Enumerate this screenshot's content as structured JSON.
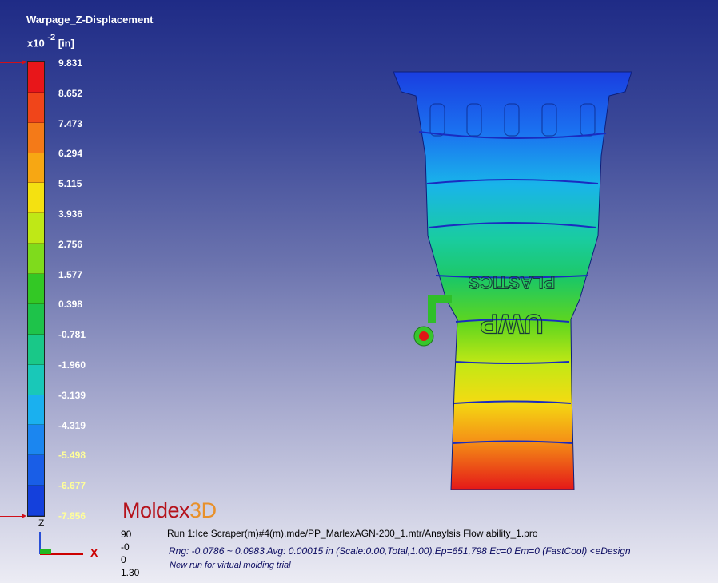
{
  "legend": {
    "title": "Warpage_Z-Displacement",
    "unit_prefix": "x10",
    "unit_exponent": "-2",
    "unit": "[in]",
    "ticks": [
      "9.831",
      "8.652",
      "7.473",
      "6.294",
      "5.115",
      "3.936",
      "2.756",
      "1.577",
      "0.398",
      "-0.781",
      "-1.960",
      "-3.139",
      "-4.319",
      "-5.498",
      "-6.677",
      "-7.856"
    ],
    "colors": [
      "#e8161a",
      "#f0451a",
      "#f47a18",
      "#f7a713",
      "#f4e111",
      "#bfe816",
      "#7fdb1c",
      "#33c825",
      "#1ec34a",
      "#19c888",
      "#19c8b8",
      "#1ab0ef",
      "#1b86f0",
      "#195ee7",
      "#1440dc"
    ]
  },
  "triad": {
    "z_label": "Z",
    "x_label": "X"
  },
  "brand": {
    "name": "Moldex",
    "suffix": "3D"
  },
  "view_values": [
    "90",
    "-0",
    "0",
    "1.30"
  ],
  "info": {
    "run": "Run 1:Ice Scraper(m)#4(m).mde/PP_MarlexAGN-200_1.mtr/Anaylsis Flow ability_1.pro",
    "range": "Rng: -0.0786 ~ 0.0983  Avg: 0.00015 in (Scale:0.00,Total,1.00),Ep=651,798 Ec=0 Em=0 (FastCool) <eDesign",
    "note": "New run for virtual molding trial"
  },
  "model": {
    "embossed_text_1": "UWP",
    "embossed_text_2": "PLASTICS"
  }
}
